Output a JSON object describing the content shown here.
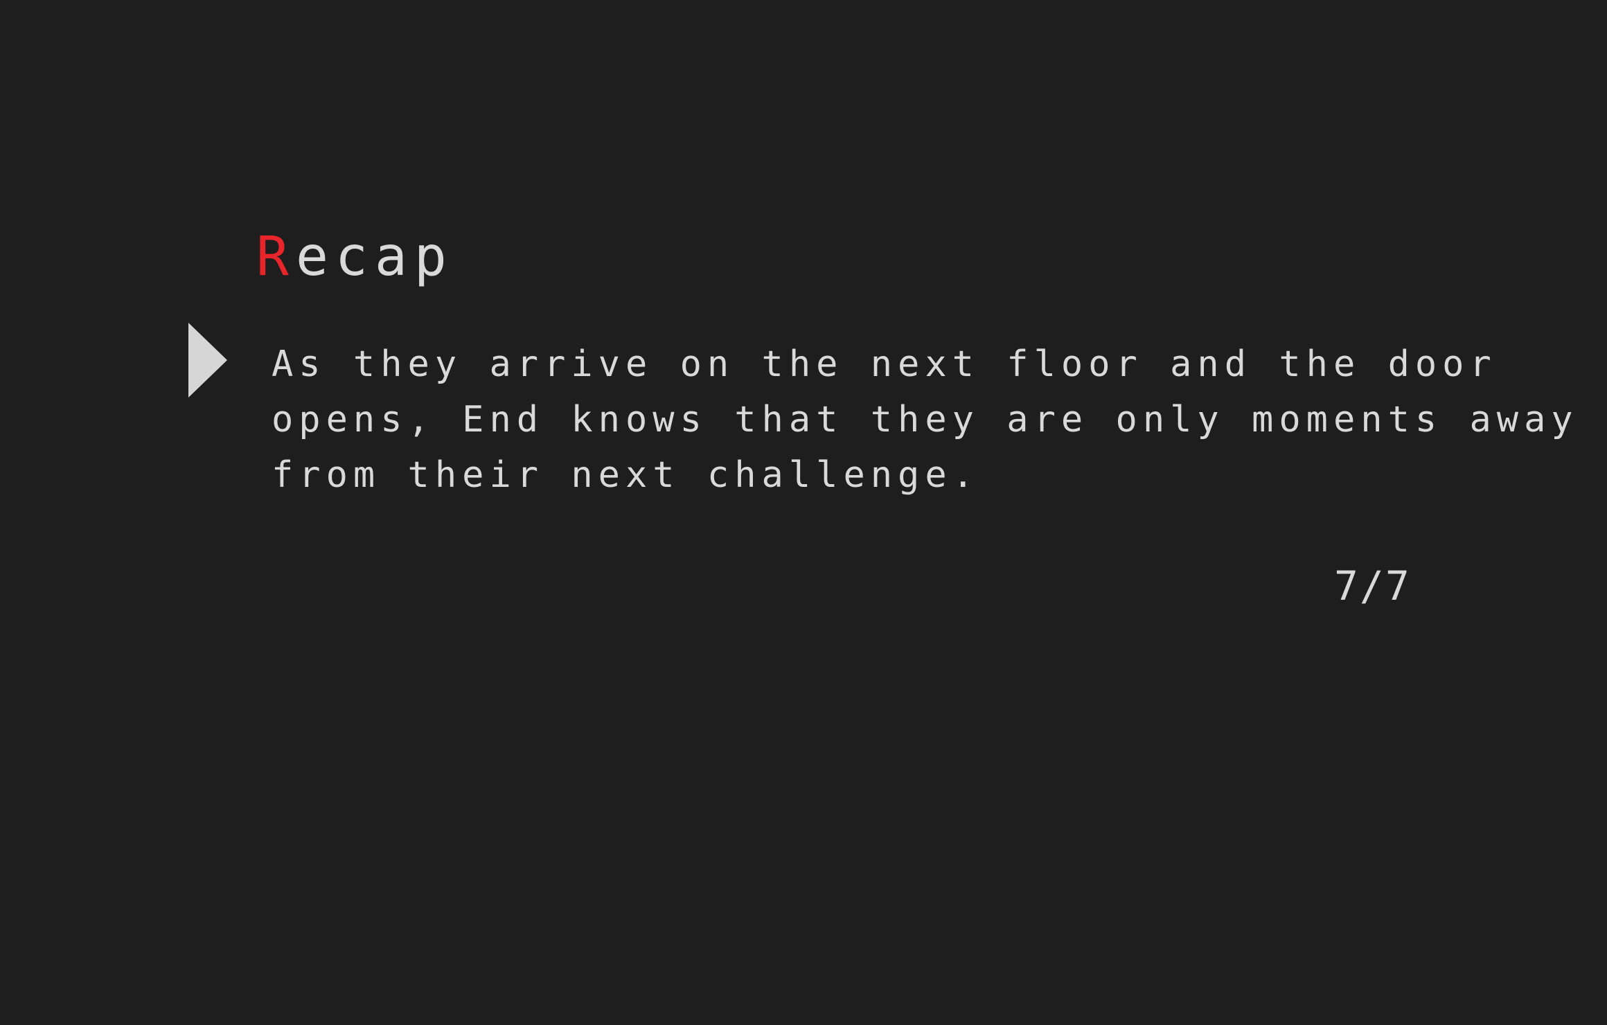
{
  "colors": {
    "background": "#1e1e1e",
    "text": "#d9d9d9",
    "accent": "#e8252a",
    "arrow": "#d6d6d6"
  },
  "heading": {
    "first_letter": "R",
    "rest": "ecap"
  },
  "dialogue": {
    "lines": [
      "As they arrive on the next floor and the door",
      "opens, End knows that they are only moments away",
      "from their next challenge."
    ]
  },
  "advance_icon": "play-triangle-icon",
  "page": {
    "counter": "7/7"
  }
}
